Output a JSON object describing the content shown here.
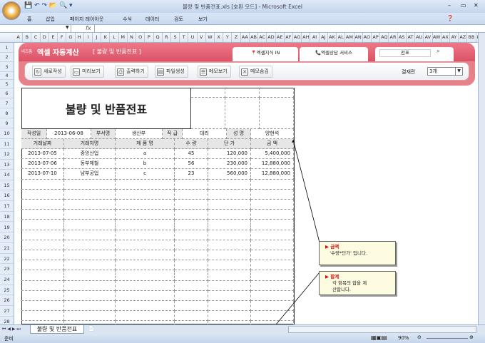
{
  "window": {
    "title": "불량 및 반품전표.xls  [호환 모드] - Microsoft Excel",
    "min": "–",
    "max": "▭",
    "close": "✕"
  },
  "ribbon_tabs": [
    "홈",
    "삽입",
    "페이지 레이아웃",
    "수식",
    "데이터",
    "검토",
    "보기"
  ],
  "formula_bar": {
    "fx": "fx",
    "name_box": "",
    "value": ""
  },
  "columns": [
    "A",
    "B",
    "C",
    "D",
    "E",
    "F",
    "G",
    "H",
    "I",
    "J",
    "K",
    "L",
    "M",
    "N",
    "O",
    "P",
    "Q",
    "R",
    "S",
    "T",
    "U",
    "V",
    "W",
    "X",
    "Y",
    "Z",
    "AA",
    "AB",
    "AC",
    "AD",
    "AE",
    "AF",
    "AG",
    "AH",
    "AI",
    "AJ",
    "AK",
    "AL",
    "AM",
    "AN",
    "AO",
    "AP",
    "AQ",
    "AR",
    "AS",
    "AT",
    "AU",
    "AV",
    "AW",
    "AX",
    "AY",
    "AZ",
    "BB",
    "BC"
  ],
  "rows": [
    "1",
    "2",
    "3",
    "4",
    "5",
    "6",
    "7",
    "8",
    "9",
    "10",
    "11",
    "12",
    "13",
    "14",
    "15",
    "16",
    "17",
    "18",
    "19",
    "20",
    "21",
    "22",
    "23",
    "24",
    "25",
    "26",
    "27",
    "28"
  ],
  "banner": {
    "brand_small": "비즈폼",
    "brand": "엑셀 자동계산",
    "subtitle": "[ 불량 및 반품전표 ]",
    "link1": "엑셀지식 IN",
    "link2": "엑셀상담 서비스",
    "search_value": "전표"
  },
  "toolbar": {
    "buttons": [
      "새로작성",
      "미리보기",
      "출력하기",
      "파일생성",
      "메모보기",
      "메모숨김"
    ],
    "approval_label": "결재란",
    "approval_value": "3개"
  },
  "form": {
    "title": "불량 및 반품전표",
    "info": {
      "date_label": "작성일",
      "date": "2013-06-08",
      "dept_label": "부서명",
      "dept": "생산부",
      "rank_label": "직 급",
      "rank": "대리",
      "name_label": "성 명",
      "name": "양현석"
    },
    "headers": [
      "거래날짜",
      "거래처명",
      "제 품 명",
      "수 량",
      "단 가",
      "금 액"
    ],
    "items": [
      [
        "2013-07-05",
        "중앙산업",
        "a",
        "45",
        "120,000",
        "5,400,000"
      ],
      [
        "2013-07-06",
        "동부제철",
        "b",
        "56",
        "230,000",
        "12,880,000"
      ],
      [
        "2013-07-10",
        "남부공업",
        "c",
        "23",
        "560,000",
        "12,880,000"
      ]
    ]
  },
  "comments": [
    {
      "title": "금액",
      "text": "'수량*단가' 입니다."
    },
    {
      "title": "합계",
      "text": "각 항목의 합을 계산합니다."
    }
  ],
  "sheet_tab": "불량 및 반품전표",
  "status": {
    "ready": "준비",
    "zoom": "90%"
  },
  "colors": {
    "banner": "#d95366",
    "accent": "#d01010"
  }
}
